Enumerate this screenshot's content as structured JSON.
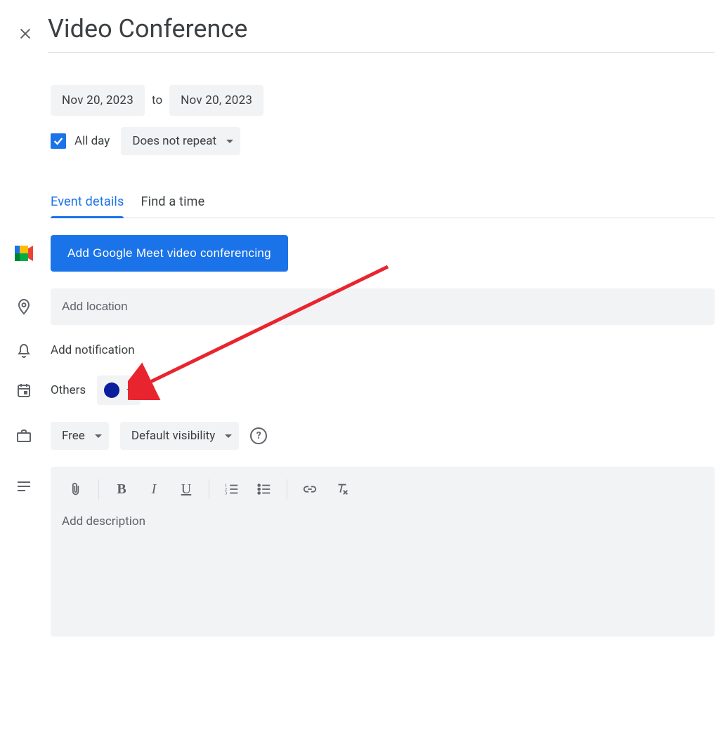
{
  "header": {
    "title": "Video Conference"
  },
  "dates": {
    "start": "Nov 20, 2023",
    "to_label": "to",
    "end": "Nov 20, 2023"
  },
  "allday": {
    "checked": true,
    "label": "All day",
    "repeat": "Does not repeat"
  },
  "tabs": {
    "details": "Event details",
    "findtime": "Find a time"
  },
  "meet": {
    "button": "Add Google Meet video conferencing"
  },
  "location": {
    "placeholder": "Add location"
  },
  "notification": {
    "label": "Add notification"
  },
  "calendar": {
    "label": "Others",
    "color": "#0b1e9e"
  },
  "availability": {
    "status": "Free",
    "visibility": "Default visibility"
  },
  "description": {
    "placeholder": "Add description"
  }
}
